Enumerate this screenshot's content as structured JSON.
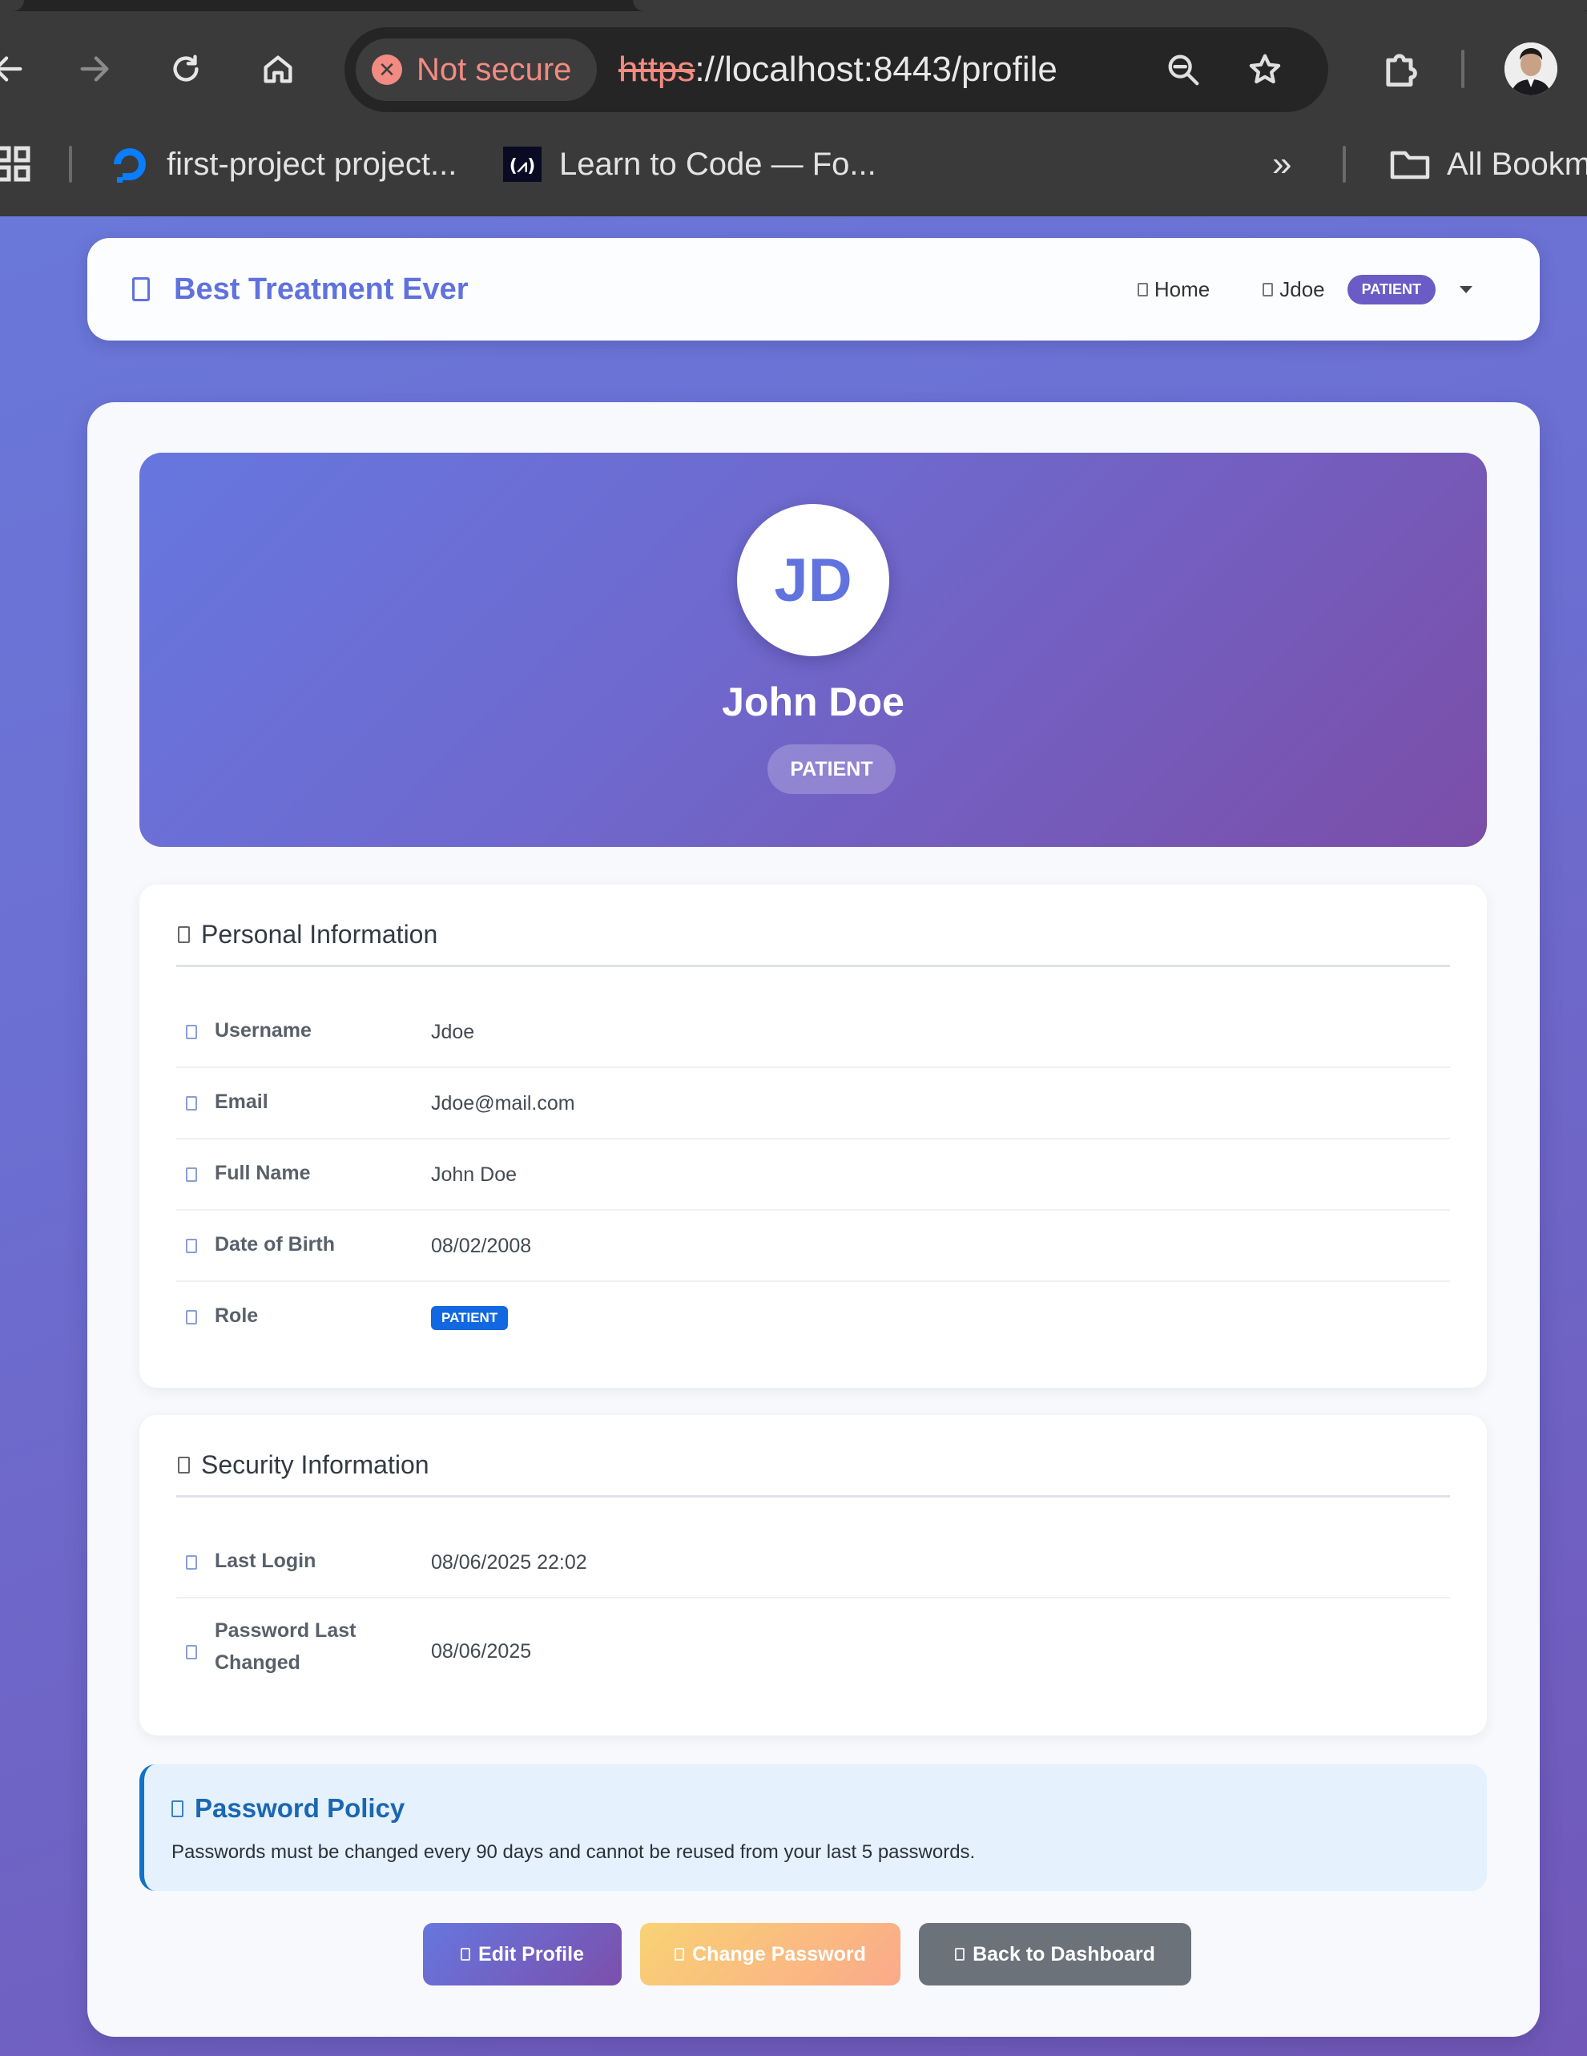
{
  "browser": {
    "security_label": "Not secure",
    "url_scheme": "https",
    "url_rest": "://localhost:8443/profile",
    "bookmarks": [
      {
        "label": "first-project project..."
      },
      {
        "label": "Learn to Code — Fo..."
      }
    ],
    "all_bookmarks_label": "All Bookm",
    "more_label": "»"
  },
  "navbar": {
    "brand": "Best Treatment Ever",
    "home_label": "Home",
    "user_label": "Jdoe",
    "role_badge": "PATIENT"
  },
  "profile": {
    "initials": "JD",
    "name": "John Doe",
    "role": "PATIENT"
  },
  "personal": {
    "title": "Personal Information",
    "rows": [
      {
        "label": "Username",
        "value": "Jdoe"
      },
      {
        "label": "Email",
        "value": "Jdoe@mail.com"
      },
      {
        "label": "Full Name",
        "value": "John Doe"
      },
      {
        "label": "Date of Birth",
        "value": "08/02/2008"
      },
      {
        "label": "Role",
        "value": "PATIENT"
      }
    ]
  },
  "security": {
    "title": "Security Information",
    "rows": [
      {
        "label": "Last Login",
        "value": "08/06/2025 22:02"
      },
      {
        "label": "Password Last Changed",
        "value": "08/06/2025"
      }
    ]
  },
  "policy": {
    "title": "Password Policy",
    "text": "Passwords must be changed every 90 days and cannot be reused from your last 5 passwords."
  },
  "actions": {
    "edit": "Edit Profile",
    "change_password": "Change Password",
    "back": "Back to Dashboard"
  },
  "colors": {
    "brand": "#5f72dd",
    "hero_start": "#6677df",
    "hero_end": "#7b4ea8",
    "role_badge": "#1168e0",
    "policy_accent": "#1172c9"
  }
}
